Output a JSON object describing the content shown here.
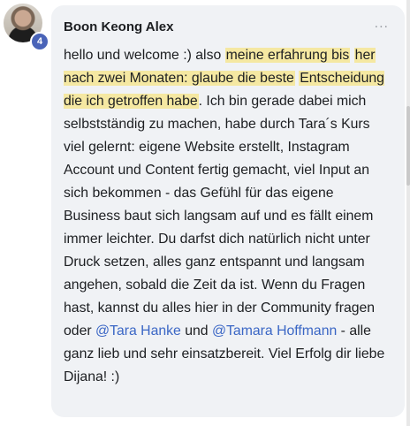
{
  "author": {
    "name": "Boon Keong Alex",
    "level": "4"
  },
  "menu": {
    "label": "..."
  },
  "comment": {
    "seg1": "hello und welcome :) also ",
    "hl1": "meine erfahrung bis",
    "hl2": "her nach zwei Monaten: glaube die beste",
    "hl3": "Entscheidung die ich getroffen habe",
    "seg2": ". Ich bin gerade dabei mich selbstständig zu machen, habe durch Tara´s Kurs viel gelernt: eigene Website erstellt, Instagram Account und Content fertig gemacht, viel Input an sich bekommen - das Gefühl für das eigene Business baut sich langsam auf und es fällt einem immer leichter. Du darfst dich natürlich nicht unter Druck setzen, alles ganz entspannt und langsam angehen, sobald die Zeit da ist. Wenn du Fragen hast, kannst du alles hier in der Community fragen oder ",
    "mention1": "@Tara Hanke",
    "seg3": " und ",
    "mention2": "@Tamara Hoffmann",
    "seg4": " - alle ganz lieb und sehr einsatzbereit. Viel Erfolg dir liebe Dijana! :)"
  },
  "colors": {
    "card_bg": "#f0f2f5",
    "highlight": "#f5e8a2",
    "mention": "#3a66c5",
    "badge": "#4a64b8"
  }
}
